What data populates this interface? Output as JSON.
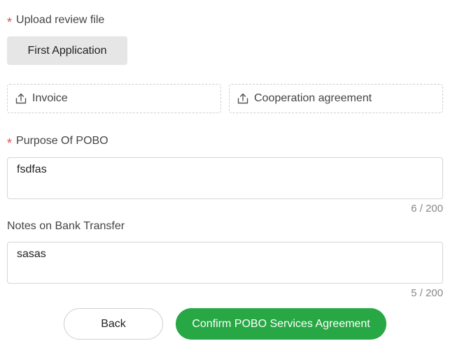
{
  "form": {
    "upload_section": {
      "required_mark": "*",
      "label": "Upload review file",
      "chip_label": "First Application",
      "uploads": [
        {
          "label": "Invoice",
          "icon": "upload-icon"
        },
        {
          "label": "Cooperation agreement",
          "icon": "upload-icon"
        }
      ]
    },
    "purpose": {
      "required_mark": "*",
      "label": "Purpose Of POBO",
      "value": "fsdfas",
      "counter": "6 / 200"
    },
    "notes": {
      "label": "Notes on Bank Transfer",
      "value": "sasas",
      "counter": "5 / 200"
    }
  },
  "actions": {
    "back_label": "Back",
    "confirm_label": "Confirm POBO Services Agreement"
  },
  "colors": {
    "required": "#e5484d",
    "confirm_bg": "#27a844",
    "chip_bg": "#e6e6e6",
    "text": "#444444",
    "counter": "#888888"
  }
}
